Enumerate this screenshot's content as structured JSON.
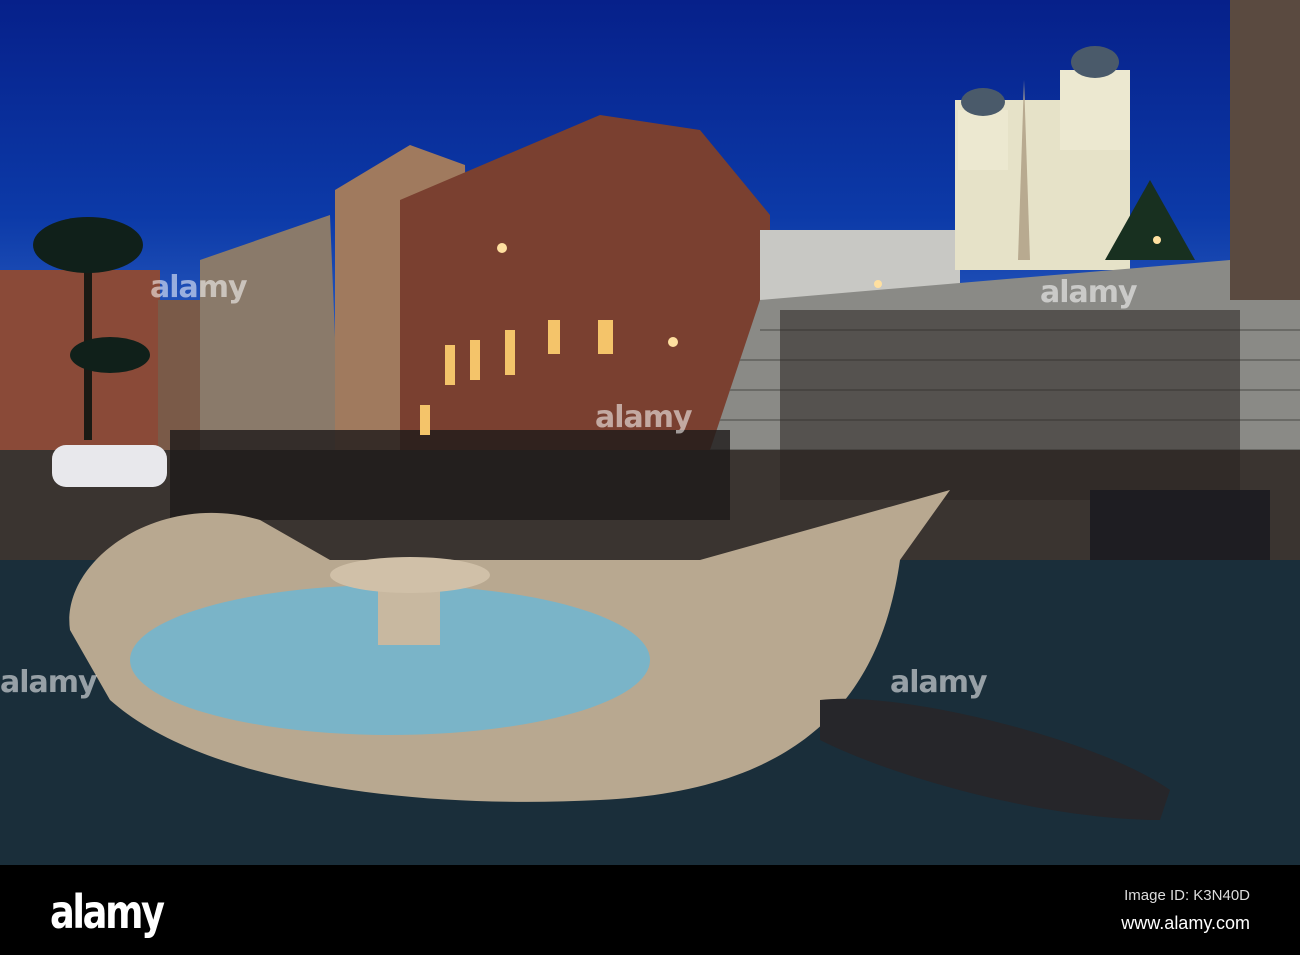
{
  "photo": {
    "subject": "Fontana della Barcaccia and Spanish Steps at dusk",
    "watermark_text": "alamy"
  },
  "footer": {
    "logo": "alamy",
    "image_id": "Image ID: K3N40D",
    "website": "www.alamy.com"
  }
}
